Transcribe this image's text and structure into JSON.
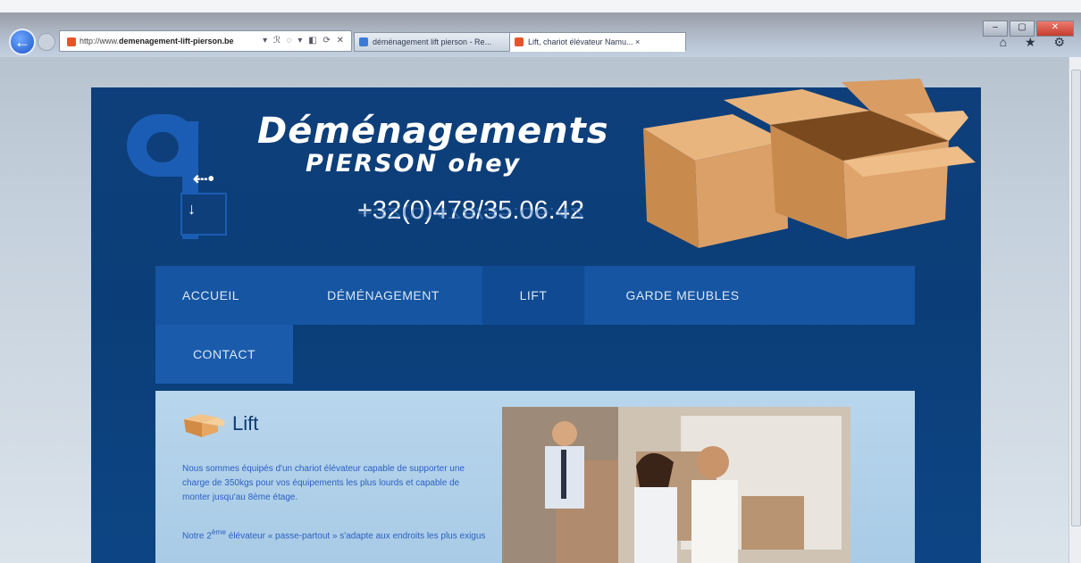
{
  "browser": {
    "address_text_prefix": "http://www.",
    "address_text_domain": "demenagement-lift-pierson.be",
    "address_controls": "▾ ℛ ◌ ▾ ◧ ⟳ ✕",
    "tabs": [
      {
        "label": "déménagement lift pierson - Re..."
      },
      {
        "label": "Lift, chariot élévateur Namu...   ×"
      }
    ],
    "window_controls": [
      "–",
      "▢",
      "✕"
    ],
    "right_icons": "⌂ ★ ⚙"
  },
  "site": {
    "title": "Déménagements",
    "subtitle": "PIERSON ohey",
    "phone": "+32(0)478/35.06.42",
    "nav": [
      {
        "label": "ACCUEIL"
      },
      {
        "label": "DÉMÉNAGEMENT"
      },
      {
        "label": "LIFT"
      },
      {
        "label": "GARDE MEUBLES"
      },
      {
        "label": "CONTACT"
      }
    ],
    "content": {
      "heading": "Lift",
      "paragraph1": "Nous sommes équipés d'un chariot élévateur capable de supporter une charge de 350kgs pour vos équipements les plus lourds et capable de monter jusqu'au 8ème étage.",
      "paragraph2_pre": "Notre 2",
      "paragraph2_sup": "ème",
      "paragraph2_post": " élévateur « passe-partout » s'adapte aux endroits les plus exigus"
    }
  },
  "colors": {
    "site_bg": "#0e3f7a",
    "nav_bg": "#1555a2",
    "nav_active": "#0f4a93",
    "content_bg": "#b8d6ec",
    "text_blue": "#2a5fc4",
    "box_orange": "#d9a06a"
  }
}
